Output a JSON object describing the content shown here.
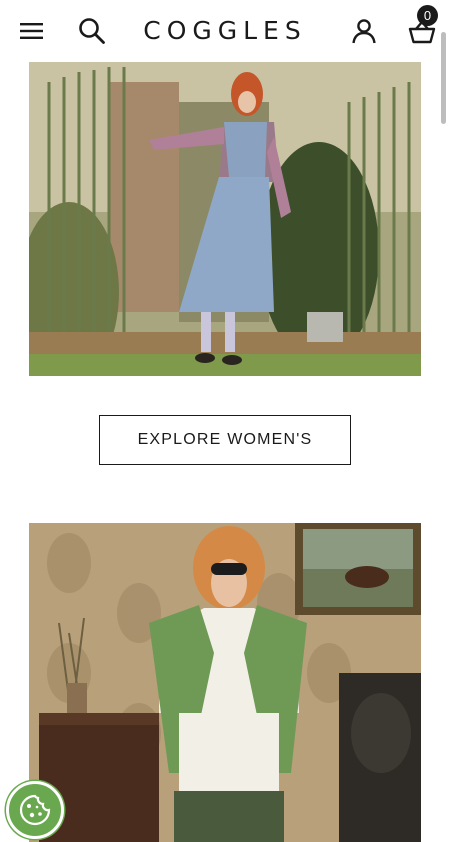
{
  "header": {
    "logo": "COGGLES",
    "basket_count": "0",
    "icons": [
      "menu-icon",
      "search-icon",
      "account-icon",
      "basket-icon"
    ]
  },
  "main": {
    "hero_1": {
      "subject": "womenswear editorial"
    },
    "cta_womens": "EXPLORE WOMEN'S",
    "hero_2": {
      "subject": "menswear editorial"
    }
  },
  "cookie_button": {
    "icon": "cookie-icon",
    "color": "#6aa84f"
  }
}
